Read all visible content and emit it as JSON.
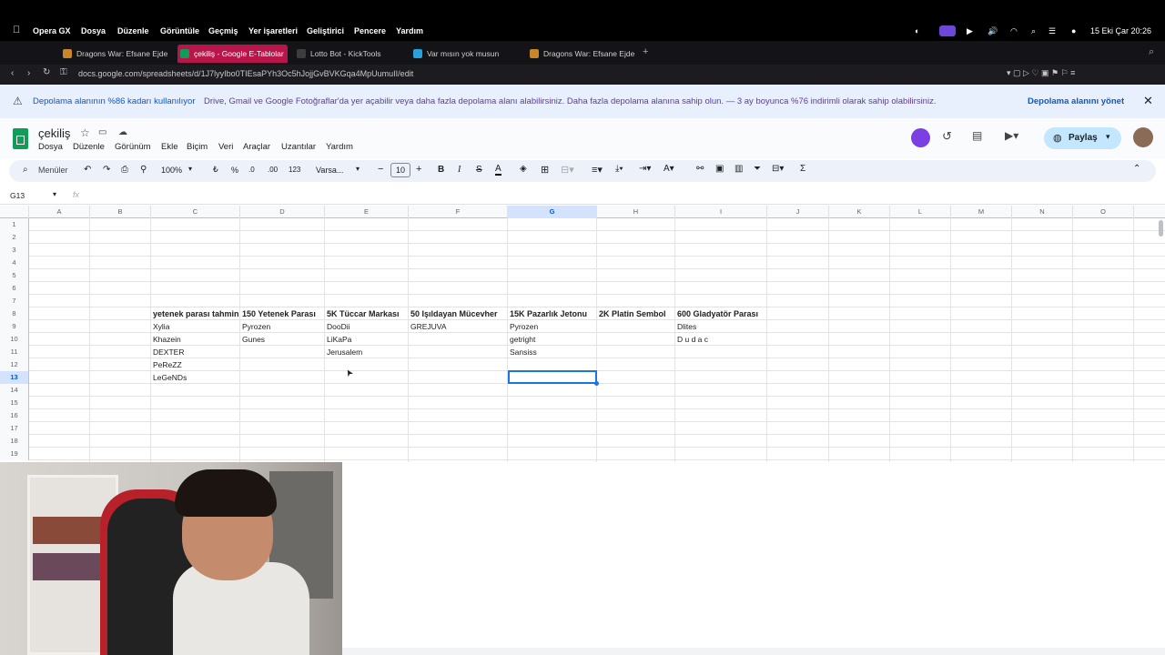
{
  "macbar": {
    "app": "Opera GX",
    "menus": [
      "Dosya",
      "Düzenle",
      "Görüntüle",
      "Geçmiş",
      "Yer işaretleri",
      "Geliştirici",
      "Pencere",
      "Yardım"
    ],
    "clock": "15 Eki Çar 20:26"
  },
  "tabs": [
    {
      "label": "Dragons War: Efsane Ejde",
      "active": false
    },
    {
      "label": "çekiliş - Google E-Tablolar",
      "active": true
    },
    {
      "label": "Lotto Bot - KickTools",
      "active": false
    },
    {
      "label": "Var mısın yok musun",
      "active": false
    },
    {
      "label": "Dragons War: Efsane Ejde",
      "active": false
    }
  ],
  "url": "docs.google.com/spreadsheets/d/1J7lyyIbo0TIEsaPYh3Oc5hJojjGvBVKGqa4MpUumuII/edit",
  "banner": {
    "title": "Depolama alanının %86 kadarı kullanılıyor",
    "text": "Drive, Gmail ve Google Fotoğraflar'da yer açabilir veya daha fazla depolama alanı alabilirsiniz. Daha fazla depolama alanına sahip olun. — 3 ay boyunca %76 indirimli olarak sahip olabilirsiniz.",
    "manage": "Depolama alanını yönet"
  },
  "doc": {
    "title": "çekiliş",
    "menus": [
      "Dosya",
      "Düzenle",
      "Görünüm",
      "Ekle",
      "Biçim",
      "Veri",
      "Araçlar",
      "Uzantılar",
      "Yardım"
    ],
    "share": "Paylaş"
  },
  "toolbar": {
    "search": "Menüler",
    "zoom": "100%",
    "percent": "%",
    "dec_less": ".0",
    "dec_more": ".00",
    "numfmt": "123",
    "font": "Varsa...",
    "fontsize": "10"
  },
  "namebox": "G13",
  "columns": [
    "A",
    "B",
    "C",
    "D",
    "E",
    "F",
    "G",
    "H",
    "I",
    "J",
    "K",
    "L",
    "M",
    "N",
    "O"
  ],
  "rows": [
    "1",
    "2",
    "3",
    "4",
    "5",
    "6",
    "7",
    "8",
    "9",
    "10",
    "11",
    "12",
    "13",
    "14",
    "15",
    "16",
    "17",
    "18",
    "19"
  ],
  "sheet": {
    "headers": {
      "C": "yetenek parası tahmin",
      "D": "150 Yetenek Parası",
      "E": "5K Tüccar Markası",
      "F": "50 Işıldayan Mücevher",
      "G": "15K Pazarlık Jetonu",
      "H": "2K Platin Sembol",
      "I": "600 Gladyatör Parası"
    },
    "C": [
      "Xylia",
      "Khazein",
      "DEXTER",
      "PeReZZ",
      "LeGeNDs"
    ],
    "D": [
      "Pyrozen",
      "Gunes"
    ],
    "E": [
      "DooDii",
      "LiKaPa",
      "Jerusalem"
    ],
    "F": [
      "GREJUVA"
    ],
    "G": [
      "Pyrozen",
      "getright",
      "Sansiss"
    ],
    "I": [
      "Dlites",
      "D u d a c"
    ]
  },
  "colors": {
    "accent": "#1a73e8",
    "tab_active": "#b8164a",
    "banner": "#e8f0fe"
  }
}
